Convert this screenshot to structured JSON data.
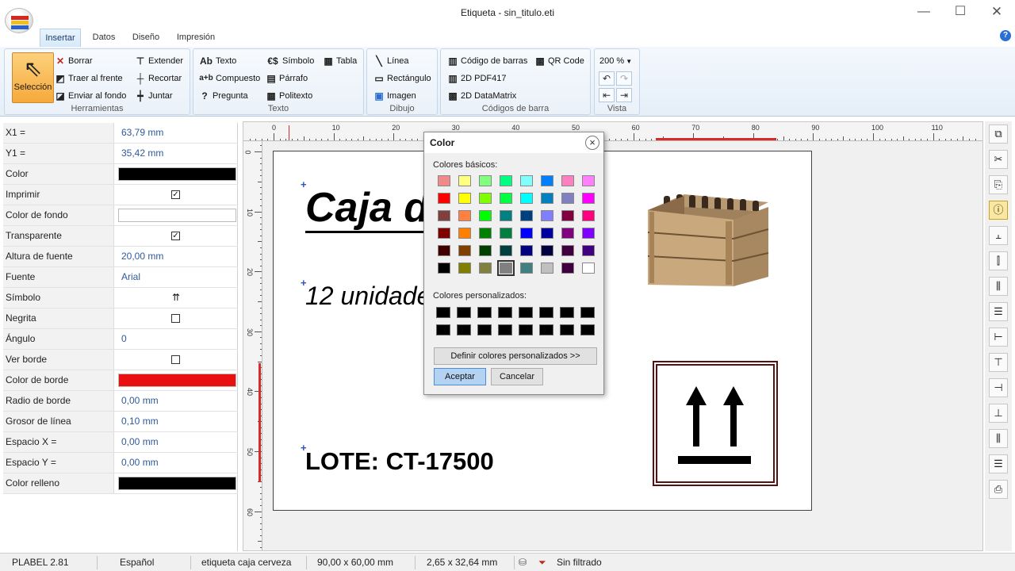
{
  "window": {
    "title": "Etiqueta - sin_titulo.eti",
    "minimize_glyph": "—",
    "maximize_glyph": "☐",
    "close_glyph": "✕"
  },
  "ribbon_tabs": [
    "Insertar",
    "Datos",
    "Diseño",
    "Impresión"
  ],
  "active_tab": "Insertar",
  "help_glyph": "?",
  "ribbon": {
    "herramientas": {
      "label": "Herramientas",
      "selection": "Selección",
      "borrar": "Borrar",
      "traer_al_frente": "Traer al frente",
      "enviar_al_fondo": "Enviar al fondo",
      "extender": "Extender",
      "recortar": "Recortar",
      "juntar": "Juntar"
    },
    "texto": {
      "label": "Texto",
      "texto": "Texto",
      "compuesto": "Compuesto",
      "pregunta": "Pregunta",
      "simbolo": "Símbolo",
      "parrafo": "Párrafo",
      "politexto": "Politexto",
      "tabla": "Tabla"
    },
    "dibujo": {
      "label": "Dibujo",
      "linea": "Línea",
      "rectangulo": "Rectángulo",
      "imagen": "Imagen"
    },
    "codigos": {
      "label": "Códigos de barra",
      "codigo_barras": "Código de barras",
      "qr_code": "QR Code",
      "pdf417": "2D PDF417",
      "datamatrix": "2D DataMatrix"
    },
    "vista": {
      "label": "Vista",
      "zoom": "200 %"
    }
  },
  "properties": [
    {
      "name": "X1 =",
      "value": "63,79 mm",
      "type": "text"
    },
    {
      "name": "Y1 =",
      "value": "35,42 mm",
      "type": "text"
    },
    {
      "name": "Color",
      "value": "#000000",
      "type": "color"
    },
    {
      "name": "Imprimir",
      "value": "✓",
      "type": "check"
    },
    {
      "name": "Color de fondo",
      "value": "#ffffff",
      "type": "color"
    },
    {
      "name": "Transparente",
      "value": "✓",
      "type": "check"
    },
    {
      "name": "Altura de fuente",
      "value": "20,00 mm",
      "type": "text"
    },
    {
      "name": "Fuente",
      "value": "Arial",
      "type": "text"
    },
    {
      "name": "Símbolo",
      "value": "⇈",
      "type": "text"
    },
    {
      "name": "Negrita",
      "value": "",
      "type": "check"
    },
    {
      "name": "Ángulo",
      "value": "0",
      "type": "text"
    },
    {
      "name": "Ver borde",
      "value": "",
      "type": "check"
    },
    {
      "name": "Color de borde",
      "value": "#e81010",
      "type": "color"
    },
    {
      "name": "Radio de borde",
      "value": "0,00 mm",
      "type": "text"
    },
    {
      "name": "Grosor de línea",
      "value": "0,10 mm",
      "type": "text"
    },
    {
      "name": "Espacio X =",
      "value": "0,00 mm",
      "type": "text"
    },
    {
      "name": "Espacio Y =",
      "value": "0,00 mm",
      "type": "text"
    },
    {
      "name": "Color relleno",
      "value": "#000000",
      "type": "color"
    }
  ],
  "ruler": {
    "h_numbers": [
      "0",
      "10",
      "20",
      "30",
      "40",
      "50",
      "60",
      "70",
      "80",
      "90",
      "100",
      "110"
    ],
    "v_numbers": [
      "0",
      "10",
      "20",
      "30",
      "40",
      "50",
      "60"
    ]
  },
  "label_canvas": {
    "title_text": "Caja d",
    "units_text": "12 unidade",
    "lot_text": "LOTE: CT-17500",
    "image_name": "wooden-bottle-crate",
    "symbol_name": "this-way-up-symbol"
  },
  "color_dialog": {
    "title": "Color",
    "basic_label": "Colores básicos:",
    "custom_label": "Colores personalizados:",
    "define_button": "Definir colores personalizados >>",
    "accept_button": "Aceptar",
    "cancel_button": "Cancelar",
    "basic_colors": [
      "#f28a8a",
      "#ffff80",
      "#80ff80",
      "#00ff80",
      "#80ffff",
      "#0080ff",
      "#ff80c0",
      "#ff80ff",
      "#ff0000",
      "#ffff00",
      "#80ff00",
      "#00ff40",
      "#00ffff",
      "#0080c0",
      "#8080c0",
      "#ff00ff",
      "#804040",
      "#ff8040",
      "#00ff00",
      "#008080",
      "#004080",
      "#8080ff",
      "#800040",
      "#ff0080",
      "#800000",
      "#ff8000",
      "#008000",
      "#008040",
      "#0000ff",
      "#0000a0",
      "#800080",
      "#8000ff",
      "#400000",
      "#804000",
      "#004000",
      "#004040",
      "#000080",
      "#000040",
      "#400040",
      "#400080",
      "#000000",
      "#808000",
      "#808040",
      "#808080",
      "#408080",
      "#c0c0c0",
      "#400040",
      "#ffffff"
    ],
    "selected_index": 43,
    "custom_colors": [
      "#000000",
      "#000000",
      "#000000",
      "#000000",
      "#000000",
      "#000000",
      "#000000",
      "#000000",
      "#000000",
      "#000000",
      "#000000",
      "#000000",
      "#000000",
      "#000000",
      "#000000",
      "#000000"
    ]
  },
  "status": {
    "version": "PLABEL 2.81",
    "language": "Español",
    "label_name": "etiqueta caja cerveza",
    "size": "90,00 x 60,00 mm",
    "cursor": "2,65 x 32,64 mm",
    "filter": "Sin filtrado"
  },
  "right_tools": [
    "copy-icon",
    "cut-icon",
    "paste-icon",
    "info-icon",
    "align-top-icon",
    "align-center-v-icon",
    "distribute-h-icon",
    "align-middle-icon",
    "align-left-icon",
    "align-top-edge-icon",
    "align-right-icon",
    "align-bottom-icon",
    "distribute-v-icon",
    "center-h-icon",
    "print-icon"
  ]
}
